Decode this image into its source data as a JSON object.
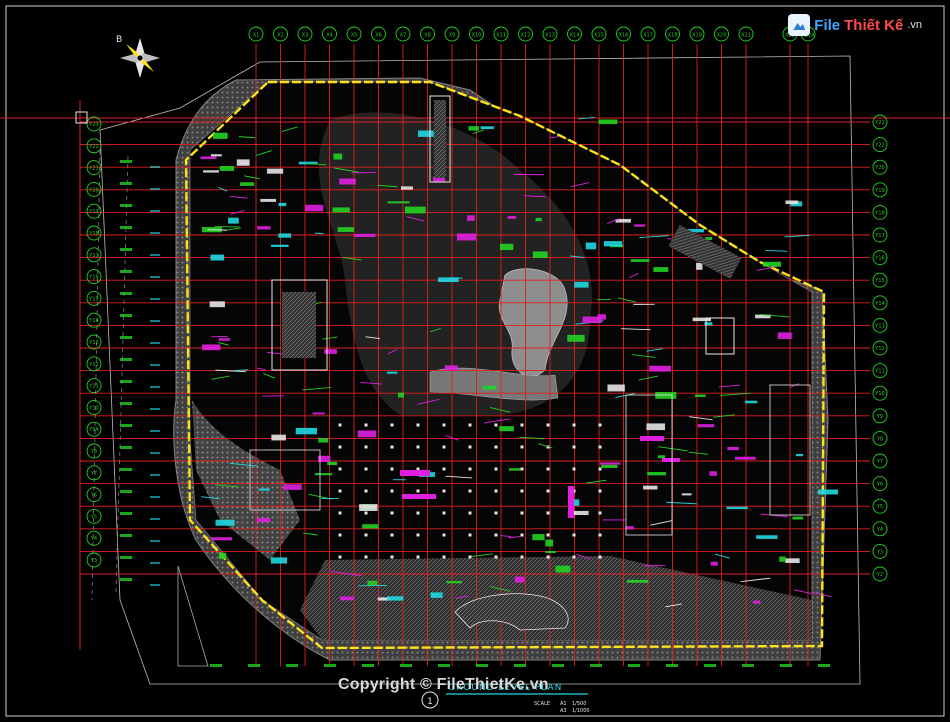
{
  "watermark": {
    "brand_part1": "File",
    "brand_part2": "Thiết Kế",
    "brand_suffix": ".vn",
    "copyright": "Copyright © FileThietKe.vn"
  },
  "drawing": {
    "north_label": "B",
    "title": "GROUND LEVEL PLAN",
    "scale_label": "SCALE",
    "scale_a1_label": "A1",
    "scale_a1": "1/500",
    "scale_a3_label": "A3",
    "scale_a3": "1/1000",
    "callout_number": "1"
  },
  "grid": {
    "x_axes": [
      "X1",
      "X2",
      "X3",
      "X4",
      "X5",
      "X6",
      "X7",
      "X8",
      "X9",
      "X10",
      "X11",
      "X12",
      "X13",
      "X14",
      "X15",
      "X16",
      "X17",
      "X18",
      "X19",
      "X20",
      "X21",
      "X22",
      "X22A"
    ],
    "y_axes_right": [
      "Y21",
      "Y22",
      "Y20",
      "Y19",
      "Y18",
      "Y17",
      "Y16",
      "Y15",
      "Y14",
      "Y13",
      "Y12",
      "Y11",
      "Y10",
      "Y9",
      "Y8",
      "Y7",
      "Y6",
      "Y5",
      "Y4",
      "Y3",
      "Y2"
    ],
    "y_axes_left": [
      "Y23",
      "Y22",
      "Y21",
      "Y20",
      "Y19",
      "Y18",
      "Y17",
      "Y16",
      "Y15",
      "Y14",
      "Y13",
      "Y12",
      "Y11",
      "Y10",
      "Y9A",
      "Y8",
      "Y7",
      "Y6",
      "Y5",
      "Y4",
      "Y3"
    ]
  },
  "colors": {
    "background": "#000000",
    "grid_red": "#e02020",
    "boundary_yellow": "#ffe11a",
    "hatch_gray": "#8a8a8a",
    "green": "#22d122",
    "magenta": "#e020e0",
    "cyan": "#20d8e0",
    "white": "#e6e6e6"
  }
}
